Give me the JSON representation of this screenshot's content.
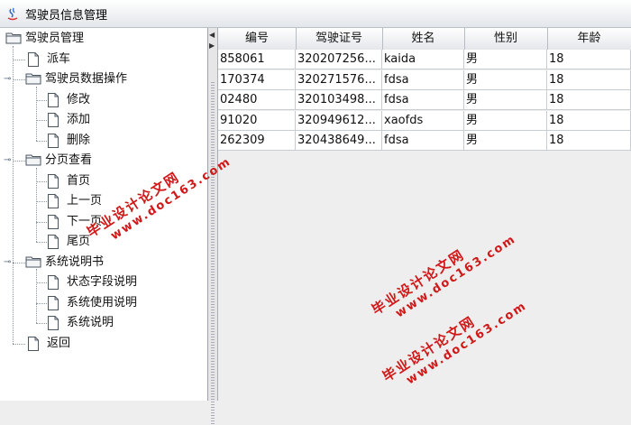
{
  "window": {
    "title": "驾驶员信息管理"
  },
  "tree": {
    "root": "驾驶员管理",
    "items": [
      {
        "label": "派车",
        "type": "leaf"
      },
      {
        "label": "驾驶员数据操作",
        "type": "folder",
        "children": [
          {
            "label": "修改"
          },
          {
            "label": "添加"
          },
          {
            "label": "删除"
          }
        ]
      },
      {
        "label": "分页查看",
        "type": "folder",
        "children": [
          {
            "label": "首页"
          },
          {
            "label": "上一页"
          },
          {
            "label": "下一页"
          },
          {
            "label": "尾页"
          }
        ]
      },
      {
        "label": "系统说明书",
        "type": "folder",
        "children": [
          {
            "label": "状态字段说明"
          },
          {
            "label": "系统使用说明"
          },
          {
            "label": "系统说明"
          }
        ]
      },
      {
        "label": "返回",
        "type": "leaf"
      }
    ]
  },
  "table": {
    "columns": [
      "编号",
      "驾驶证号",
      "姓名",
      "性别",
      "年龄"
    ],
    "rows": [
      [
        "858061",
        "320207256...",
        "kaida",
        "男",
        "18"
      ],
      [
        "170374",
        "320271576...",
        "fdsa",
        "男",
        "18"
      ],
      [
        "02480",
        "320103498...",
        "fdsa",
        "男",
        "18"
      ],
      [
        "91020",
        "320949612...",
        "xaofds",
        "男",
        "18"
      ],
      [
        "262309",
        "320438649...",
        "fdsa",
        "男",
        "18"
      ]
    ]
  },
  "watermarks": [
    {
      "line1": "毕业设计论文网",
      "line2": "www.doc163.com"
    },
    {
      "line1": "毕业设计论文网",
      "line2": "www.doc163.com"
    },
    {
      "line1": "毕业设计论文网",
      "line2": "www.doc163.com"
    }
  ]
}
